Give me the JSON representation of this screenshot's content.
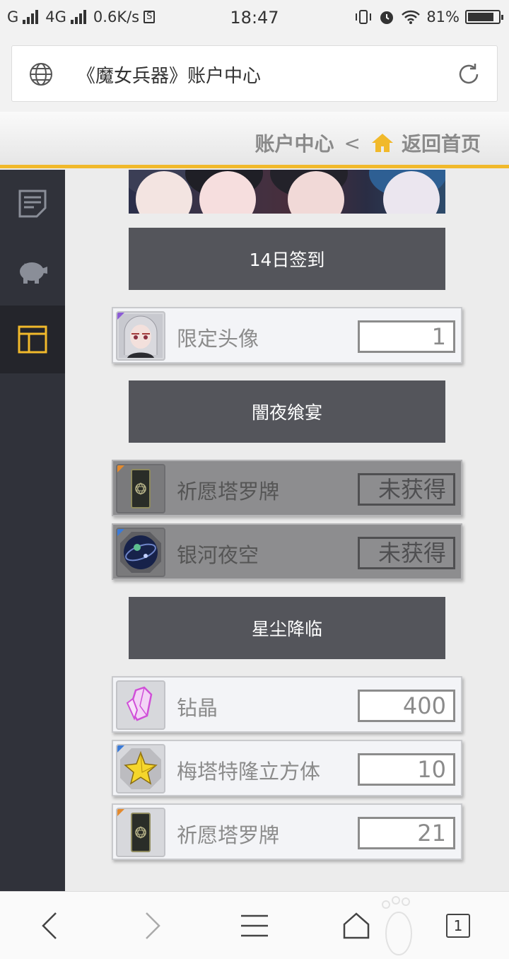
{
  "status_bar": {
    "carrier": "G",
    "network": "4G",
    "speed": "0.6K/s",
    "s_badge": "S",
    "time": "18:47",
    "battery": "81%"
  },
  "url_bar": {
    "title": "《魔女兵器》账户中心",
    "globe_icon": "globe-icon",
    "reload_icon": "reload-icon"
  },
  "header": {
    "account_center": "账户中心",
    "separator": "<",
    "home_link": "返回首页",
    "accent_color": "#f1b92b"
  },
  "sidebar": {
    "items": [
      {
        "icon": "notes-icon",
        "active": false
      },
      {
        "icon": "piggy-bank-icon",
        "active": false
      },
      {
        "icon": "layout-icon",
        "active": true
      }
    ]
  },
  "sections": [
    {
      "title": "14日签到",
      "rewards": [
        {
          "name": "限定头像",
          "qty": "1",
          "locked": false,
          "icon": "avatar-icon"
        }
      ]
    },
    {
      "title": "闇夜飨宴",
      "rewards": [
        {
          "name": "祈愿塔罗牌",
          "qty": "未获得",
          "locked": true,
          "icon": "tarot-card-icon"
        },
        {
          "name": "银河夜空",
          "qty": "未获得",
          "locked": true,
          "icon": "galaxy-icon"
        }
      ]
    },
    {
      "title": "星尘降临",
      "rewards": [
        {
          "name": "钻晶",
          "qty": "400",
          "locked": false,
          "icon": "crystal-icon"
        },
        {
          "name": "梅塔特隆立方体",
          "qty": "10",
          "locked": false,
          "icon": "star-cube-icon"
        },
        {
          "name": "祈愿塔罗牌",
          "qty": "21",
          "locked": false,
          "icon": "tarot-card-icon"
        }
      ]
    }
  ],
  "bottom_nav": {
    "tab_count": "1"
  }
}
